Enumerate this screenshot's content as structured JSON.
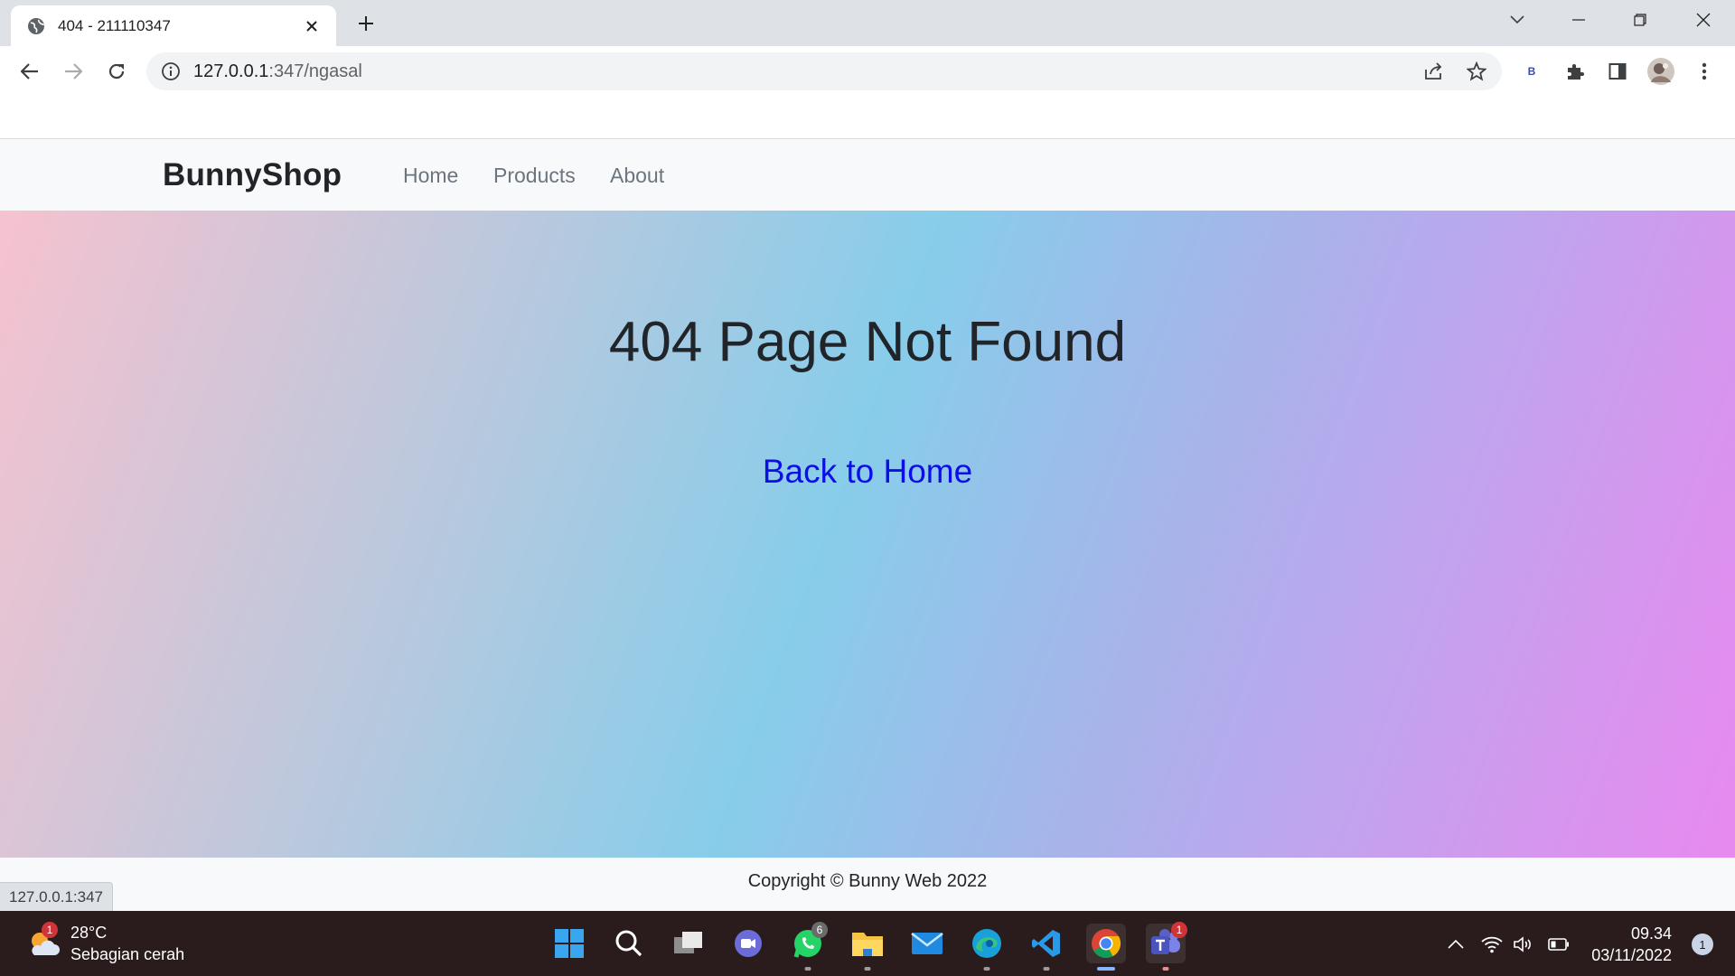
{
  "browser": {
    "tab_title": "404 - 211110347",
    "url_host": "127.0.0.1",
    "url_path": ":347/ngasal",
    "extension_label": "B"
  },
  "site": {
    "brand": "BunnyShop",
    "nav": [
      "Home",
      "Products",
      "About"
    ],
    "heading": "404 Page Not Found",
    "back_link": "Back to Home",
    "footer": "Copyright © Bunny Web 2022",
    "status_url": "127.0.0.1:347"
  },
  "taskbar": {
    "weather_temp": "28°C",
    "weather_desc": "Sebagian cerah",
    "weather_badge": "1",
    "whatsapp_badge": "6",
    "teams_badge": "1",
    "time": "09.34",
    "date": "03/11/2022",
    "notification_count": "1"
  },
  "colors": {
    "link": "#0d0dea",
    "navbar_bg": "#f8f9fa",
    "taskbar_bg": "#2a1c1c"
  }
}
